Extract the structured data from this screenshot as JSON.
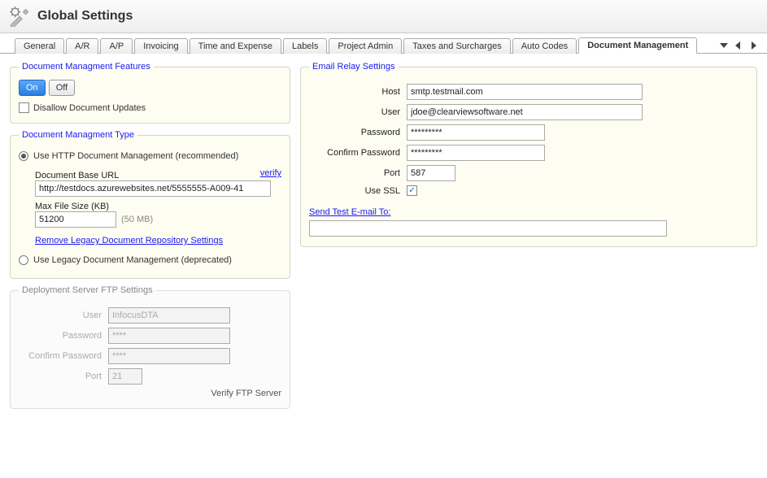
{
  "header": {
    "title": "Global Settings"
  },
  "tabs": {
    "items": [
      "General",
      "A/R",
      "A/P",
      "Invoicing",
      "Time and Expense",
      "Labels",
      "Project Admin",
      "Taxes and Surcharges",
      "Auto Codes",
      "Document Management"
    ],
    "active_index": 9
  },
  "dmf": {
    "legend": "Document Managment Features",
    "on": "On",
    "off": "Off",
    "disallow_label": "Disallow Document Updates"
  },
  "dmt": {
    "legend": "Document Managment Type",
    "http_label": "Use HTTP Document Management (recommended)",
    "base_url_label": "Document Base URL",
    "verify": "verify",
    "base_url": "http://testdocs.azurewebsites.net/5555555-A009-41",
    "max_size_label": "Max File Size (KB)",
    "max_size": "51200",
    "max_size_hint": "(50 MB)",
    "remove_link": "Remove Legacy Document Repository Settings",
    "legacy_label": "Use Legacy Document Management (deprecated)"
  },
  "ftp": {
    "legend": "Deployment Server FTP Settings",
    "user_label": "User",
    "user": "InfocusDTA",
    "pwd_label": "Password",
    "pwd": "****",
    "cpwd_label": "Confirm Password",
    "cpwd": "****",
    "port_label": "Port",
    "port": "21",
    "verify": "Verify FTP Server"
  },
  "email": {
    "legend": "Email Relay Settings",
    "host_label": "Host",
    "host": "smtp.testmail.com",
    "user_label": "User",
    "user": "jdoe@clearviewsoftware.net",
    "pwd_label": "Password",
    "pwd": "*********",
    "cpwd_label": "Confirm Password",
    "cpwd": "*********",
    "port_label": "Port",
    "port": "587",
    "ssl_label": "Use SSL",
    "ssl_checked": true,
    "sendtest_label": "Send Test E-mail To:",
    "sendtest_value": ""
  }
}
